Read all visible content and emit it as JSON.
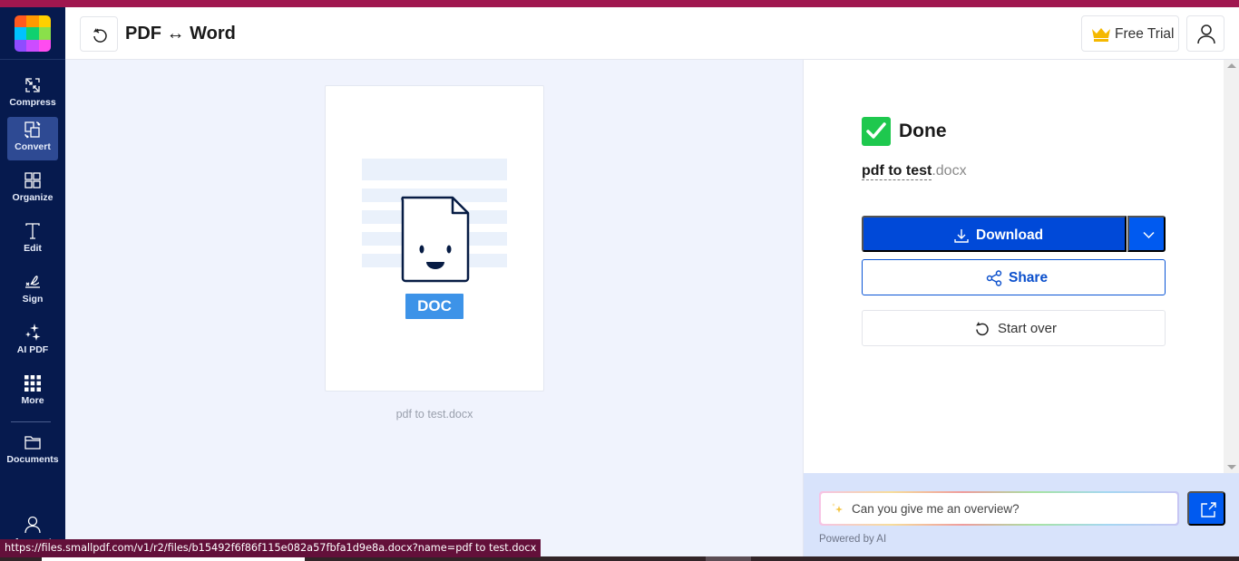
{
  "app": {
    "title": "PDF ↔ Word",
    "brand_colors": {
      "accent": "#0049d8",
      "sidebar": "#061a4e",
      "top_strip": "#a0174f",
      "success": "#1ec84e"
    }
  },
  "sidebar": {
    "logo_icon": "smallpdf-logo-icon",
    "items": [
      {
        "label": "Compress",
        "icon": "compress-icon",
        "active": false
      },
      {
        "label": "Convert",
        "icon": "convert-icon",
        "active": true
      },
      {
        "label": "Organize",
        "icon": "grid-icon",
        "active": false
      },
      {
        "label": "Edit",
        "icon": "text-cursor-icon",
        "active": false
      },
      {
        "label": "Sign",
        "icon": "signature-icon",
        "active": false
      },
      {
        "label": "AI PDF",
        "icon": "sparkles-icon",
        "active": false
      },
      {
        "label": "More",
        "icon": "dots-grid-icon",
        "active": false
      },
      {
        "label": "Documents",
        "icon": "folder-icon",
        "active": false
      },
      {
        "label": "Account",
        "icon": "user-icon",
        "active": false
      }
    ]
  },
  "header": {
    "back_icon": "undo-icon",
    "free_trial_label": "Free Trial",
    "free_trial_icon": "crown-icon",
    "account_icon": "user-icon"
  },
  "preview": {
    "badge": "DOC",
    "file_caption": "pdf to test.docx"
  },
  "result": {
    "status": "Done",
    "file_base": "pdf to test",
    "file_ext": ".docx",
    "download_label": "Download",
    "share_label": "Share",
    "start_over_label": "Start over"
  },
  "ai": {
    "input_value": "Can you give me an overview?",
    "powered_by": "Powered by AI"
  },
  "status_bar": {
    "url": "https://files.smallpdf.com/v1/r2/files/b15492f6f86f115e082a57fbfa1d9e8a.docx?name=pdf to test.docx"
  }
}
